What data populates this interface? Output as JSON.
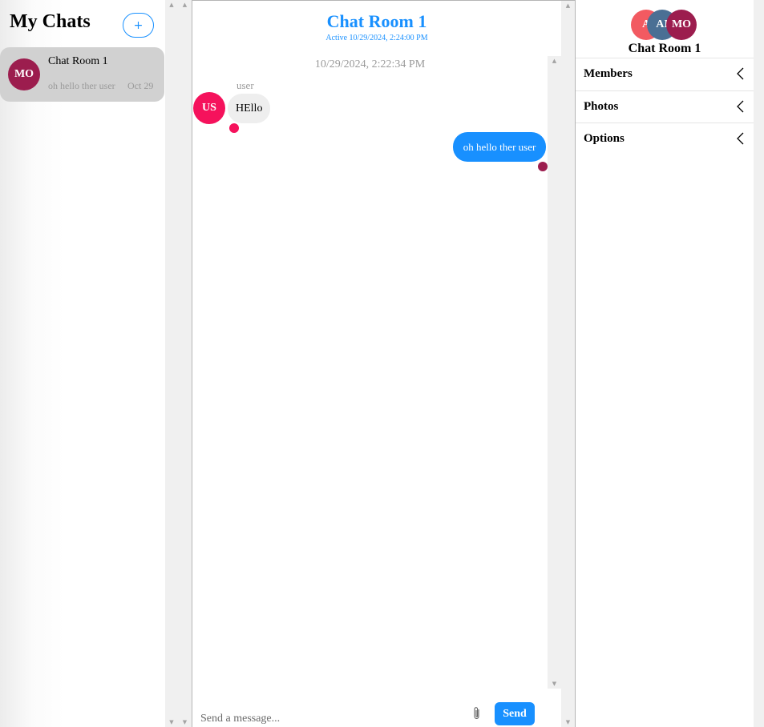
{
  "sidebar": {
    "title": "My Chats",
    "new_chat_label": "+",
    "chats": [
      {
        "avatar": "MO",
        "title": "Chat Room 1",
        "preview": "oh hello ther user",
        "date": "Oct 29"
      }
    ]
  },
  "conversation": {
    "title": "Chat Room 1",
    "active_text": "Active 10/29/2024, 2:24:00 PM",
    "timestamp": "10/29/2024, 2:22:34 PM",
    "messages": [
      {
        "sender": "user",
        "avatar": "US",
        "text": "HEllo",
        "direction": "incoming"
      },
      {
        "text": "oh hello ther user",
        "direction": "outgoing"
      }
    ],
    "composer": {
      "placeholder": "Send a message...",
      "send_label": "Send"
    }
  },
  "details": {
    "avatars": [
      "A",
      "AI",
      "MO"
    ],
    "title": "Chat Room 1",
    "sections": [
      "Members",
      "Photos",
      "Options"
    ]
  },
  "icons": {
    "attach": "paperclip-icon",
    "accordion": "chevron-left-icon",
    "scroll_up": "scroll-up-arrow",
    "scroll_down": "scroll-down-arrow"
  },
  "colors": {
    "accent": "#1890ff",
    "avatar_mo": "#9c1d4e",
    "avatar_us": "#f5125c",
    "avatar_a": "#f25a61",
    "avatar_ai": "#4a6f94",
    "selected_chat": "#d1d1d1",
    "incoming_bubble": "#eeeeee"
  },
  "scroll_glyphs": {
    "up": "▲",
    "down": "▼"
  }
}
